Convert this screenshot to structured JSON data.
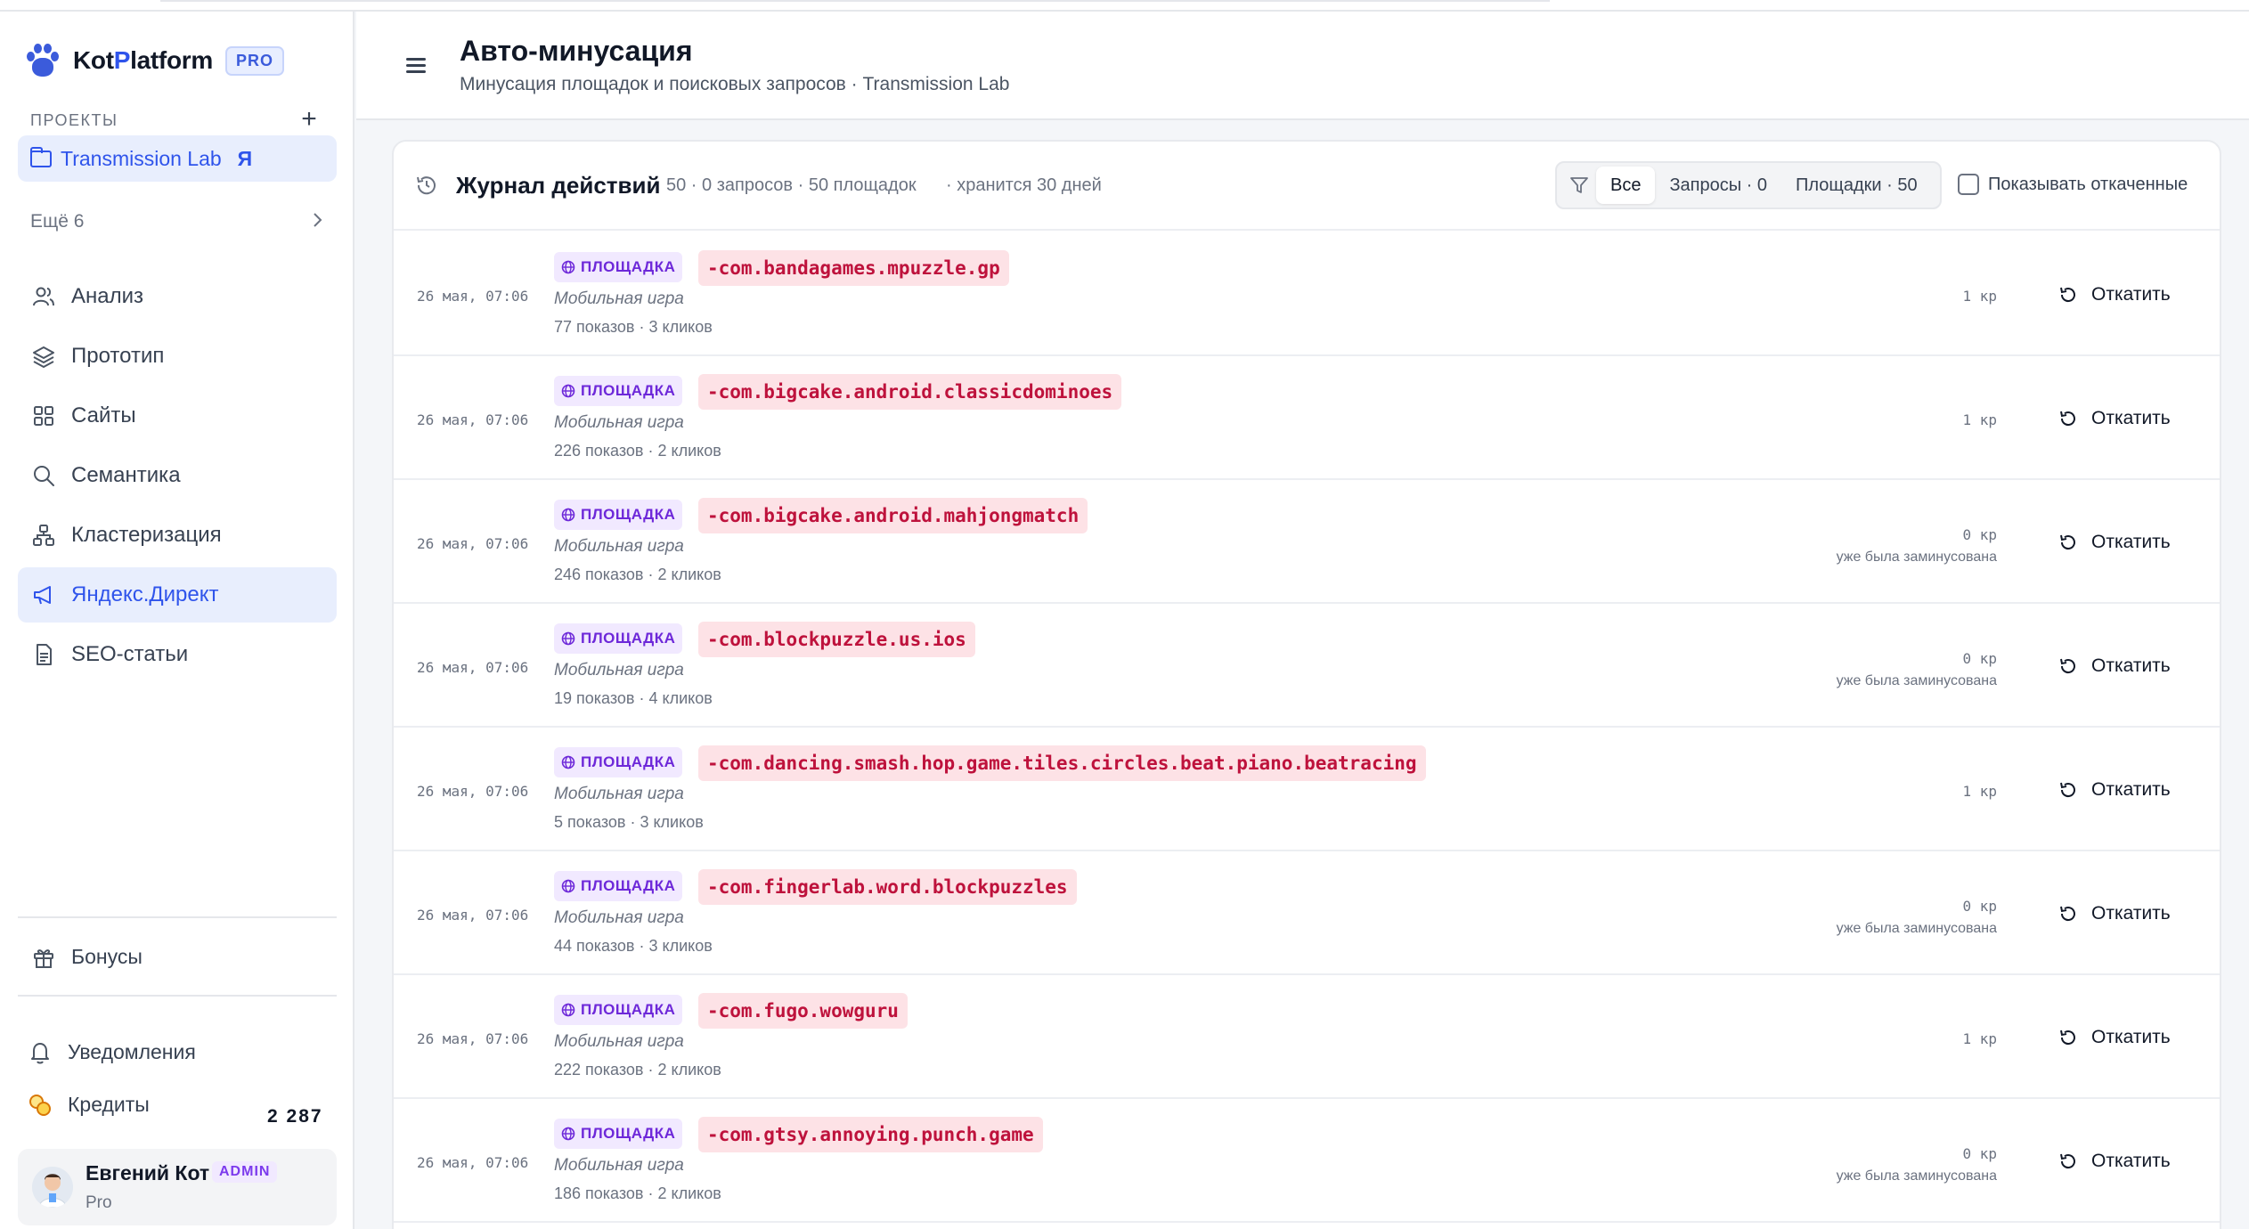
{
  "app": {
    "brand_prefix": "Kot",
    "brand_accent": "P",
    "brand_suffix": "latform",
    "plan_badge": "PRO",
    "colors": {
      "accent": "#2f54eb",
      "term_bg": "#fde2e6",
      "term_text": "#be123c",
      "badge_bg": "#f1e9ff",
      "badge_text": "#6d28d9"
    }
  },
  "sidebar": {
    "projects_label": "ПРОЕКТЫ",
    "add_icon": "plus-icon",
    "active_project": {
      "name": "Transmission Lab",
      "marker": "Я",
      "icon": "folder-icon"
    },
    "more_label": "Ещё 6",
    "nav": [
      {
        "label": "Анализ",
        "icon": "users-icon"
      },
      {
        "label": "Прототип",
        "icon": "layers-icon"
      },
      {
        "label": "Сайты",
        "icon": "grid-icon"
      },
      {
        "label": "Семантика",
        "icon": "search-icon"
      },
      {
        "label": "Кластеризация",
        "icon": "hierarchy-icon"
      },
      {
        "label": "Яндекс.Директ",
        "icon": "megaphone-icon",
        "active": true
      },
      {
        "label": "SEO-статьи",
        "icon": "document-icon"
      }
    ],
    "bonuses_label": "Бонусы",
    "notifications_label": "Уведомления",
    "credits_label": "Кредиты",
    "credits_value": "2 287",
    "user": {
      "name": "Евгений Кот",
      "role": "ADMIN",
      "plan": "Pro"
    }
  },
  "header": {
    "title": "Авто-минусация",
    "subtitle": "Минусация площадок и поисковых запросов · Transmission Lab"
  },
  "journal": {
    "title": "Журнал действий",
    "stats": "50 · 0 запросов · 50 площадок",
    "retention": "· хранится 30 дней",
    "filters": [
      "Все",
      "Запросы · 0",
      "Площадки · 50"
    ],
    "active_filter": "Все",
    "show_reverted_label": "Показывать откаченные",
    "revert_label": "Откатить",
    "rows": [
      {
        "date": "26 мая, 07:06",
        "kind": "ПЛОЩАДКА",
        "term": "-com.bandagames.mpuzzle.gp",
        "type": "Мобильная игра",
        "stats": "77 показов · 3 кликов",
        "cost": "1 кр",
        "note": ""
      },
      {
        "date": "26 мая, 07:06",
        "kind": "ПЛОЩАДКА",
        "term": "-com.bigcake.android.classicdominoes",
        "type": "Мобильная игра",
        "stats": "226 показов · 2 кликов",
        "cost": "1 кр",
        "note": ""
      },
      {
        "date": "26 мая, 07:06",
        "kind": "ПЛОЩАДКА",
        "term": "-com.bigcake.android.mahjongmatch",
        "type": "Мобильная игра",
        "stats": "246 показов · 2 кликов",
        "cost": "0 кр",
        "note": "уже была заминусована"
      },
      {
        "date": "26 мая, 07:06",
        "kind": "ПЛОЩАДКА",
        "term": "-com.blockpuzzle.us.ios",
        "type": "Мобильная игра",
        "stats": "19 показов · 4 кликов",
        "cost": "0 кр",
        "note": "уже была заминусована"
      },
      {
        "date": "26 мая, 07:06",
        "kind": "ПЛОЩАДКА",
        "term": "-com.dancing.smash.hop.game.tiles.circles.beat.piano.beatracing",
        "type": "Мобильная игра",
        "stats": "5 показов · 3 кликов",
        "cost": "1 кр",
        "note": ""
      },
      {
        "date": "26 мая, 07:06",
        "kind": "ПЛОЩАДКА",
        "term": "-com.fingerlab.word.blockpuzzles",
        "type": "Мобильная игра",
        "stats": "44 показов · 3 кликов",
        "cost": "0 кр",
        "note": "уже была заминусована"
      },
      {
        "date": "26 мая, 07:06",
        "kind": "ПЛОЩАДКА",
        "term": "-com.fugo.wowguru",
        "type": "Мобильная игра",
        "stats": "222 показов · 2 кликов",
        "cost": "1 кр",
        "note": ""
      },
      {
        "date": "26 мая, 07:06",
        "kind": "ПЛОЩАДКА",
        "term": "-com.gtsy.annoying.punch.game",
        "type": "Мобильная игра",
        "stats": "186 показов · 2 кликов",
        "cost": "0 кр",
        "note": "уже была заминусована"
      }
    ]
  }
}
